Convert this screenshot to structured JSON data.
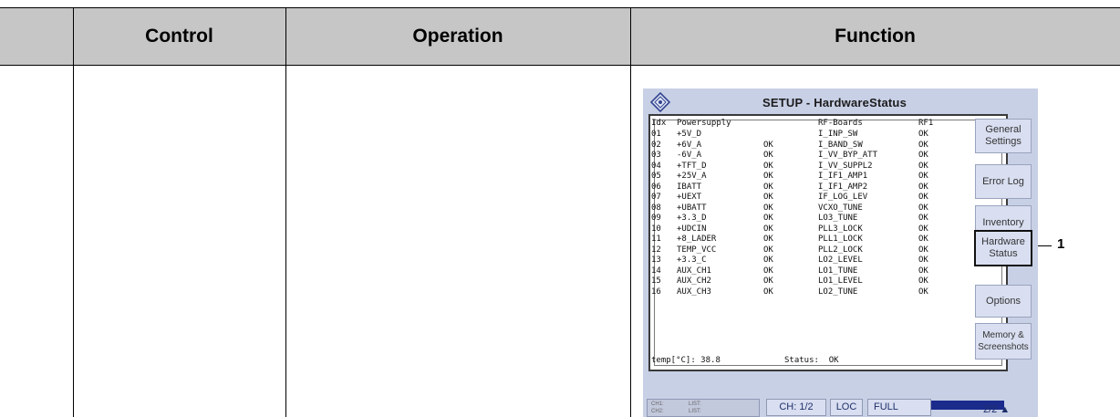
{
  "table": {
    "headers": [
      "Control",
      "Operation",
      "Function"
    ]
  },
  "screen": {
    "title": "SETUP - HardwareStatus",
    "header_row": {
      "idx": "Idx",
      "group1": "Powersupply",
      "group2": "RF-Boards",
      "group3": "RF1"
    },
    "rows": [
      {
        "idx": "01",
        "supply": "+5V_D",
        "supply_status": "",
        "board": "I_INP_SW",
        "board_status": "OK"
      },
      {
        "idx": "02",
        "supply": "+6V_A",
        "supply_status": "OK",
        "board": "I_BAND_SW",
        "board_status": "OK"
      },
      {
        "idx": "03",
        "supply": "-6V_A",
        "supply_status": "OK",
        "board": "I_VV_BYP_ATT",
        "board_status": "OK"
      },
      {
        "idx": "04",
        "supply": "+TFT_D",
        "supply_status": "OK",
        "board": "I_VV_SUPPL2",
        "board_status": "OK"
      },
      {
        "idx": "05",
        "supply": "+25V_A",
        "supply_status": "OK",
        "board": "I_IF1_AMP1",
        "board_status": "OK"
      },
      {
        "idx": "06",
        "supply": "IBATT",
        "supply_status": "OK",
        "board": "I_IF1_AMP2",
        "board_status": "OK"
      },
      {
        "idx": "07",
        "supply": "+UEXT",
        "supply_status": "OK",
        "board": "IF_LOG_LEV",
        "board_status": "OK"
      },
      {
        "idx": "08",
        "supply": "+UBATT",
        "supply_status": "OK",
        "board": "VCXO_TUNE",
        "board_status": "OK"
      },
      {
        "idx": "09",
        "supply": "+3.3_D",
        "supply_status": "OK",
        "board": "LO3_TUNE",
        "board_status": "OK"
      },
      {
        "idx": "10",
        "supply": "+UDCIN",
        "supply_status": "OK",
        "board": "PLL3_LOCK",
        "board_status": "OK"
      },
      {
        "idx": "11",
        "supply": "+8_LADER",
        "supply_status": "OK",
        "board": "PLL1_LOCK",
        "board_status": "OK"
      },
      {
        "idx": "12",
        "supply": "TEMP_VCC",
        "supply_status": "OK",
        "board": "PLL2_LOCK",
        "board_status": "OK"
      },
      {
        "idx": "13",
        "supply": "+3.3_C",
        "supply_status": "OK",
        "board": "LO2_LEVEL",
        "board_status": "OK"
      },
      {
        "idx": "14",
        "supply": "AUX_CH1",
        "supply_status": "OK",
        "board": "LO1_TUNE",
        "board_status": "OK"
      },
      {
        "idx": "15",
        "supply": "AUX_CH2",
        "supply_status": "OK",
        "board": "LO1_LEVEL",
        "board_status": "OK"
      },
      {
        "idx": "16",
        "supply": "AUX_CH3",
        "supply_status": "OK",
        "board": "LO2_TUNE",
        "board_status": "OK"
      }
    ],
    "footer": {
      "temp": "temp[°C]: 38.8",
      "status": "Status:  OK"
    },
    "softkeys": {
      "general_settings": "General Settings",
      "error_log": "Error Log",
      "inventory": "Inventory",
      "hardware_status": "Hardware Status",
      "options": "Options",
      "memory_screenshots": "Memory & Screenshots"
    },
    "bottom_bar": {
      "ch1": "CH1:",
      "ch2": "CH2:",
      "list1": "LIST:",
      "list2": "LIST:",
      "channel": "CH: 1/2",
      "loc": "LOC",
      "full": "FULL",
      "page": "2/2 ▲"
    },
    "colors": {
      "screen_bg": "#c8d0e6",
      "header_bg": "#c6c6c6",
      "level_bar": "#1a2b8c"
    }
  },
  "callout": {
    "number": "1"
  }
}
